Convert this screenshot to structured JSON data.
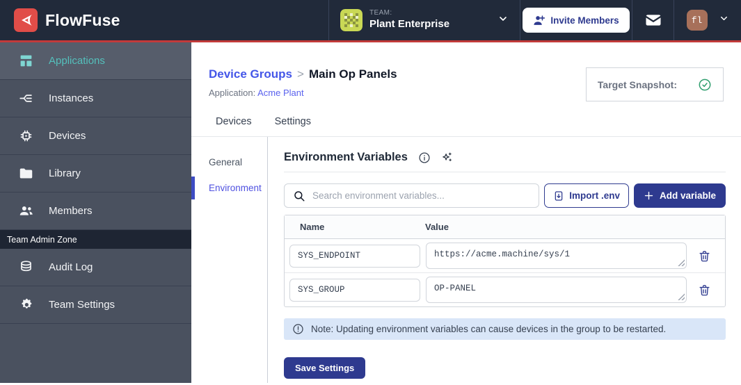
{
  "header": {
    "brand": "FlowFuse",
    "team_label": "TEAM:",
    "team_name": "Plant Enterprise",
    "invite_button": "Invite Members",
    "avatar_initials": "fl"
  },
  "sidebar": {
    "items": [
      {
        "label": "Applications",
        "icon": "applications-icon",
        "active": true
      },
      {
        "label": "Instances",
        "icon": "instances-icon",
        "active": false
      },
      {
        "label": "Devices",
        "icon": "devices-icon",
        "active": false
      },
      {
        "label": "Library",
        "icon": "library-icon",
        "active": false
      },
      {
        "label": "Members",
        "icon": "members-icon",
        "active": false
      }
    ],
    "admin_zone_label": "Team Admin Zone",
    "admin_items": [
      {
        "label": "Audit Log",
        "icon": "audit-log-icon"
      },
      {
        "label": "Team Settings",
        "icon": "team-settings-icon"
      }
    ]
  },
  "breadcrumb": {
    "parent": "Device Groups",
    "separator": ">",
    "current": "Main Op Panels",
    "application_label": "Application:",
    "application_name": "Acme Plant"
  },
  "target_snapshot": {
    "label": "Target Snapshot:"
  },
  "tabs": [
    {
      "label": "Devices"
    },
    {
      "label": "Settings"
    }
  ],
  "subnav": [
    {
      "label": "General",
      "active": false
    },
    {
      "label": "Environment",
      "active": true
    }
  ],
  "env_section": {
    "title": "Environment Variables",
    "search_placeholder": "Search environment variables...",
    "import_button": "Import .env",
    "add_button": "+ Add variable",
    "add_button_label": "Add variable",
    "table": {
      "columns": [
        "Name",
        "Value"
      ],
      "rows": [
        {
          "name": "SYS_ENDPOINT",
          "value": "https://acme.machine/sys/1"
        },
        {
          "name": "SYS_GROUP",
          "value": "OP-PANEL"
        }
      ]
    },
    "note": "Note: Updating environment variables can cause devices in the group to be restarted.",
    "save_button": "Save Settings"
  },
  "colors": {
    "navbar_bg": "#212a3a",
    "accent_red": "#c23a3a",
    "brand_red": "#e14d48",
    "sidebar_bg": "#4a515f",
    "sidebar_active_teal": "#54c0bc",
    "primary_navy": "#2e3a8f",
    "link_indigo": "#4456e8",
    "subnav_active_indigo": "#4f51e0",
    "note_bg": "#d9e6f8",
    "success_green": "#2f9e6e",
    "team_avatar_green": "#c9d855",
    "user_avatar_brown": "#a7705a"
  }
}
